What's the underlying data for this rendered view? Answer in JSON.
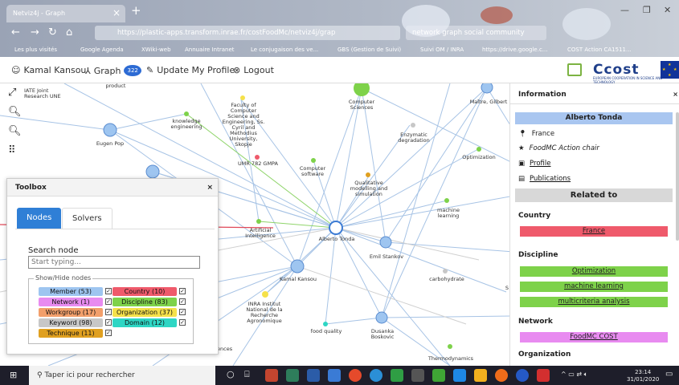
{
  "browser": {
    "tab_title": "Netviz4j - Graph",
    "url": "https://plastic-apps.transform.inrae.fr/costFoodMc/netviz4j/grap",
    "search_text": "network graph social community",
    "bookmarks": [
      "Les plus visités",
      "Google Agenda",
      "XWiki-web",
      "Annuaire Intranet",
      "Le conjugaison des ve...",
      "GBS (Gestion de Suivi)",
      "Suivi OM / INRA",
      "https://drive.google.c...",
      "COST Action CA1511..."
    ]
  },
  "appbar": {
    "user": "Kamal Kansou",
    "graph_label": "Graph",
    "graph_count": "322",
    "update_label": "Update My Profile",
    "logout_label": "Logout",
    "brand": "Ccost",
    "brand_sub": "EUROPEAN COOPERATION IN SCIENCE AND TECHNOLOGY"
  },
  "graph_labels": {
    "product": "product",
    "iate": "IATE Joint Research UNE",
    "eugen": "Eugen Pop",
    "knowledge": "knowledge engineering",
    "faculty": "Faculty of Computer Science and Engineering, Ss. Cyril and Methodius University, Skopje",
    "umr": "UMR 782 GMPA",
    "computer_sciences": "Computer Sciences",
    "computer_software": "Computer software",
    "enzymatic": "Enzymatic degradation",
    "maitre": "Maître, Gilbert",
    "optimization": "Optimization",
    "qualitative": "Qualitative modelling and simulation",
    "machine": "machine learning",
    "ai": "Artificial Intelligence",
    "alberto": "Alberto Tonda",
    "emil": "Emil Stankov",
    "carbohydrate": "carbohydrate",
    "kamal": "Kamal Kansou",
    "inra": "INRA Institut National de la Recherche Agronomique",
    "food": "food quality",
    "dusanka": "Dusanka Boskovic",
    "thermo": "Thermodynamics",
    "ences": "ences",
    "s": "S"
  },
  "toolbox": {
    "title": "Toolbox",
    "close": "×",
    "tab_nodes": "Nodes",
    "tab_solvers": "Solvers",
    "search_label": "Search node",
    "search_placeholder": "Start typing...",
    "legend": "Show/Hide nodes",
    "chips": [
      {
        "label": "Member (53)",
        "color": "#9ec5f0",
        "checked": "✓"
      },
      {
        "label": "Country (10)",
        "color": "#ef5a6b",
        "checked": "✓"
      },
      {
        "label": "Network (1)",
        "color": "#e88bf0",
        "checked": "✓"
      },
      {
        "label": "Discipline (83)",
        "color": "#7ed24a",
        "checked": "✓"
      },
      {
        "label": "Workgroup (17)",
        "color": "#f29f6b",
        "checked": "✓"
      },
      {
        "label": "Organization (37)",
        "color": "#f5e14a",
        "checked": "✓"
      },
      {
        "label": "Keyword (98)",
        "color": "#c7c7c7",
        "checked": "✓"
      },
      {
        "label": "Domain (12)",
        "color": "#2ed6c4",
        "checked": "✓"
      },
      {
        "label": "Technique (11)",
        "color": "#e0a020",
        "checked": "✓"
      }
    ]
  },
  "info": {
    "title": "Information",
    "close": "×",
    "person": "Alberto Tonda",
    "country": "France",
    "role": "FoodMC Action chair",
    "profile_link": "Profile",
    "publications_link": "Publications",
    "related_title": "Related to",
    "country_heading": "Country",
    "country_items": [
      "France"
    ],
    "discipline_heading": "Discipline",
    "discipline_items": [
      "Optimization",
      "machine learning",
      "multicriteria analysis"
    ],
    "network_heading": "Network",
    "network_items": [
      "FoodMC COST"
    ],
    "organization_heading": "Organization",
    "country_color": "#ef5a6b",
    "discipline_color": "#7ed24a",
    "network_color": "#e88bf0"
  },
  "taskbar": {
    "search_placeholder": "Taper ici pour rechercher",
    "time": "23:14",
    "date": "31/01/2020"
  }
}
